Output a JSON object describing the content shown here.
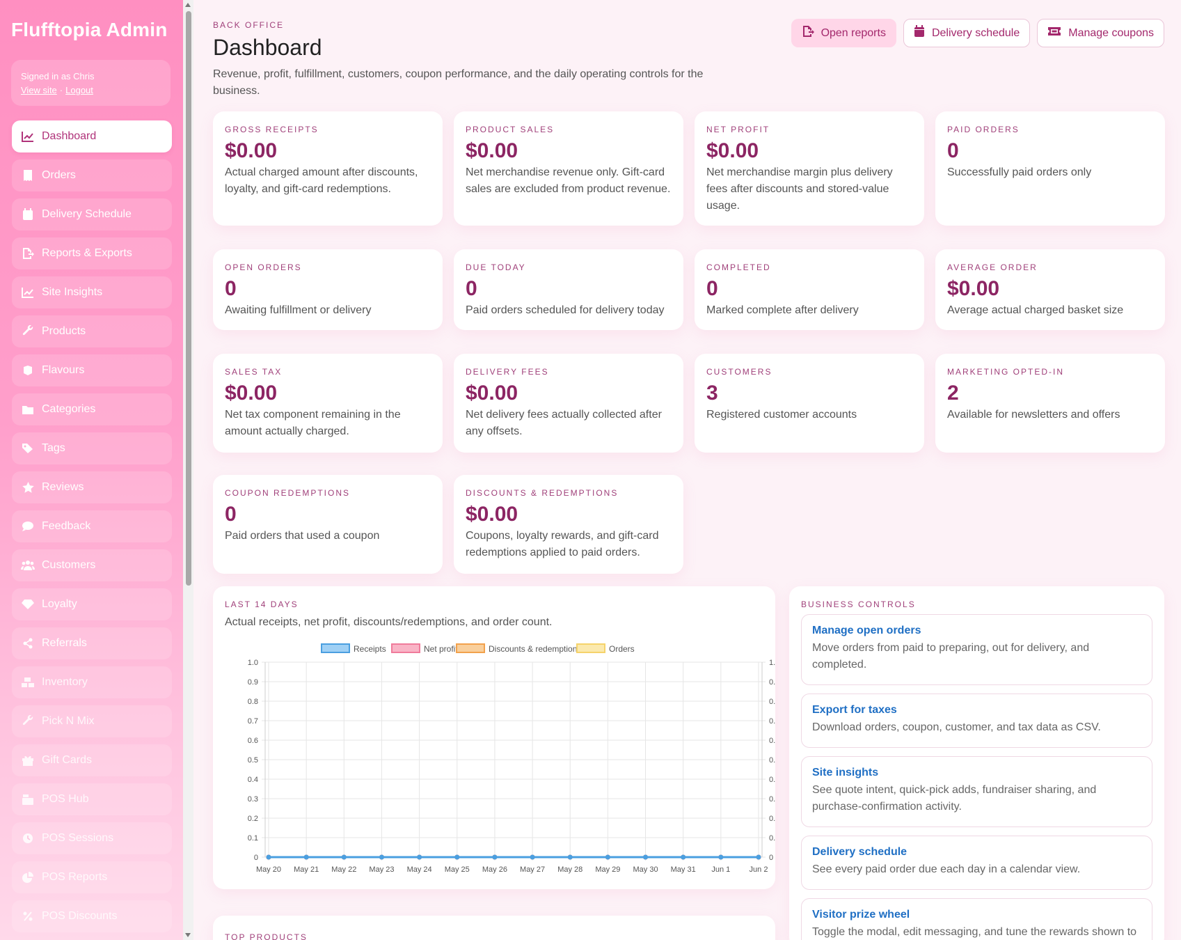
{
  "sidebar": {
    "brand": "Flufftopia Admin",
    "signed_in": "Signed in as Chris",
    "view_site": "View site",
    "separator": "·",
    "logout": "Logout",
    "items": [
      {
        "label": "Dashboard",
        "icon": "chart-line-icon"
      },
      {
        "label": "Orders",
        "icon": "receipt-icon"
      },
      {
        "label": "Delivery Schedule",
        "icon": "calendar-icon"
      },
      {
        "label": "Reports & Exports",
        "icon": "file-export-icon"
      },
      {
        "label": "Site Insights",
        "icon": "chart-line-icon"
      },
      {
        "label": "Products",
        "icon": "wrench-icon"
      },
      {
        "label": "Flavours",
        "icon": "cube-icon"
      },
      {
        "label": "Categories",
        "icon": "folder-icon"
      },
      {
        "label": "Tags",
        "icon": "tags-icon"
      },
      {
        "label": "Reviews",
        "icon": "star-icon"
      },
      {
        "label": "Feedback",
        "icon": "comment-icon"
      },
      {
        "label": "Customers",
        "icon": "users-icon"
      },
      {
        "label": "Loyalty",
        "icon": "gem-icon"
      },
      {
        "label": "Referrals",
        "icon": "share-icon"
      },
      {
        "label": "Inventory",
        "icon": "boxes-icon"
      },
      {
        "label": "Pick N Mix",
        "icon": "wrench-icon"
      },
      {
        "label": "Gift Cards",
        "icon": "gift-icon"
      },
      {
        "label": "POS Hub",
        "icon": "cash-register-icon"
      },
      {
        "label": "POS Sessions",
        "icon": "clock-icon"
      },
      {
        "label": "POS Reports",
        "icon": "chart-pie-icon"
      },
      {
        "label": "POS Discounts",
        "icon": "percent-icon"
      }
    ]
  },
  "header": {
    "eyebrow": "BACK OFFICE",
    "title": "Dashboard",
    "description": "Revenue, profit, fulfillment, customers, coupon performance, and the daily operating controls for the business.",
    "buttons": {
      "open_reports": "Open reports",
      "delivery_schedule": "Delivery schedule",
      "manage_coupons": "Manage coupons"
    }
  },
  "stats": [
    {
      "label": "GROSS RECEIPTS",
      "value": "$0.00",
      "note": "Actual charged amount after discounts, loyalty, and gift-card redemptions."
    },
    {
      "label": "PRODUCT SALES",
      "value": "$0.00",
      "note": "Net merchandise revenue only. Gift-card sales are excluded from product revenue."
    },
    {
      "label": "NET PROFIT",
      "value": "$0.00",
      "note": "Net merchandise margin plus delivery fees after discounts and stored-value usage."
    },
    {
      "label": "PAID ORDERS",
      "value": "0",
      "note": "Successfully paid orders only"
    },
    {
      "label": "OPEN ORDERS",
      "value": "0",
      "note": "Awaiting fulfillment or delivery"
    },
    {
      "label": "DUE TODAY",
      "value": "0",
      "note": "Paid orders scheduled for delivery today"
    },
    {
      "label": "COMPLETED",
      "value": "0",
      "note": "Marked complete after delivery"
    },
    {
      "label": "AVERAGE ORDER",
      "value": "$0.00",
      "note": "Average actual charged basket size"
    },
    {
      "label": "SALES TAX",
      "value": "$0.00",
      "note": "Net tax component remaining in the amount actually charged."
    },
    {
      "label": "DELIVERY FEES",
      "value": "$0.00",
      "note": "Net delivery fees actually collected after any offsets."
    },
    {
      "label": "CUSTOMERS",
      "value": "3",
      "note": "Registered customer accounts"
    },
    {
      "label": "MARKETING OPTED-IN",
      "value": "2",
      "note": "Available for newsletters and offers"
    },
    {
      "label": "COUPON REDEMPTIONS",
      "value": "0",
      "note": "Paid orders that used a coupon"
    },
    {
      "label": "DISCOUNTS & REDEMPTIONS",
      "value": "$0.00",
      "note": "Coupons, loyalty rewards, and gift-card redemptions applied to paid orders."
    }
  ],
  "chart_section": {
    "eyebrow": "LAST 14 DAYS",
    "subtitle": "Actual receipts, net profit, discounts/redemptions, and order count."
  },
  "chart_data": {
    "type": "line",
    "categories": [
      "May 20",
      "May 21",
      "May 22",
      "May 23",
      "May 24",
      "May 25",
      "May 26",
      "May 27",
      "May 28",
      "May 29",
      "May 30",
      "May 31",
      "Jun 1",
      "Jun 2"
    ],
    "series": [
      {
        "name": "Receipts",
        "color": "#4a9fe0",
        "fill": "#9fd0f5",
        "values": [
          0,
          0,
          0,
          0,
          0,
          0,
          0,
          0,
          0,
          0,
          0,
          0,
          0,
          0
        ]
      },
      {
        "name": "Net profit",
        "color": "#f07b9b",
        "fill": "#f9b4c6",
        "values": [
          0,
          0,
          0,
          0,
          0,
          0,
          0,
          0,
          0,
          0,
          0,
          0,
          0,
          0
        ]
      },
      {
        "name": "Discounts & redemptions",
        "color": "#f2a14c",
        "fill": "#f9cf9c",
        "values": [
          0,
          0,
          0,
          0,
          0,
          0,
          0,
          0,
          0,
          0,
          0,
          0,
          0,
          0
        ]
      },
      {
        "name": "Orders",
        "color": "#f5d36b",
        "fill": "#fbe9ae",
        "values": [
          0,
          0,
          0,
          0,
          0,
          0,
          0,
          0,
          0,
          0,
          0,
          0,
          0,
          0
        ]
      }
    ],
    "y_ticks": [
      "0",
      "0.1",
      "0.2",
      "0.3",
      "0.4",
      "0.5",
      "0.6",
      "0.7",
      "0.8",
      "0.9",
      "1.0"
    ],
    "ylim": [
      0,
      1
    ],
    "y2lim": [
      0,
      1
    ],
    "grid": true,
    "legend": "top-center"
  },
  "controls": {
    "eyebrow": "BUSINESS CONTROLS",
    "items": [
      {
        "title": "Manage open orders",
        "desc": "Move orders from paid to preparing, out for delivery, and completed."
      },
      {
        "title": "Export for taxes",
        "desc": "Download orders, coupon, customer, and tax data as CSV."
      },
      {
        "title": "Site insights",
        "desc": "See quote intent, quick-pick adds, fundraiser sharing, and purchase-confirmation activity."
      },
      {
        "title": "Delivery schedule",
        "desc": "See every paid order due each day in a calendar view."
      },
      {
        "title": "Visitor prize wheel",
        "desc": "Toggle the modal, edit messaging, and tune the rewards shown to"
      }
    ]
  },
  "top_products": {
    "eyebrow": "TOP PRODUCTS"
  }
}
